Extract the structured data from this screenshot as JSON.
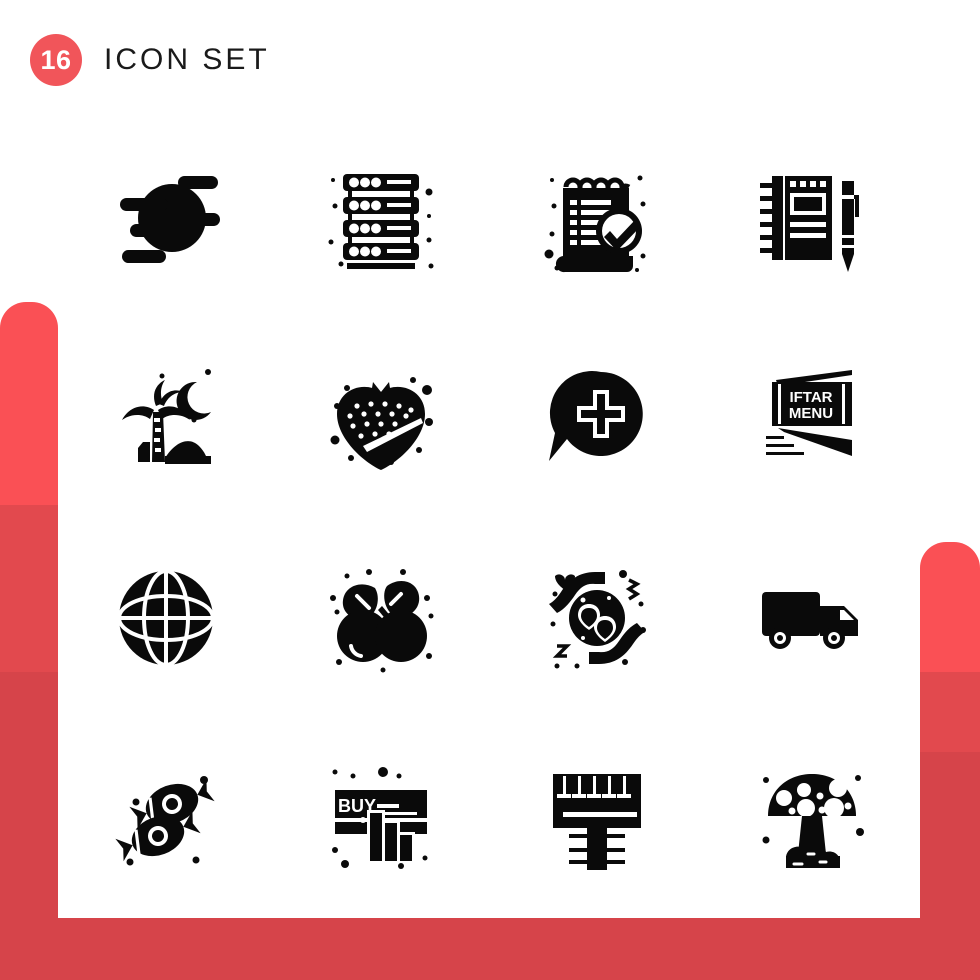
{
  "header": {
    "count": "16",
    "title": "Icon Set"
  },
  "theme": {
    "accent": "#f1555a",
    "accent_light": "#fa5055",
    "accent_mid": "#e2494e",
    "accent_dark": "#d6444a",
    "icon_color": "#0a0a0a",
    "card_bg": "#ffffff"
  },
  "grid": {
    "columns": 4,
    "rows": 4,
    "icons": [
      {
        "index": 1,
        "name": "speed-motion-icon",
        "label": "Fast Speed Motion"
      },
      {
        "index": 2,
        "name": "server-rack-icon",
        "label": "Server Rack"
      },
      {
        "index": 3,
        "name": "checklist-notepad-icon",
        "label": "Checklist Notepad"
      },
      {
        "index": 4,
        "name": "notebook-pen-icon",
        "label": "Notebook And Pen"
      },
      {
        "index": 5,
        "name": "oasis-night-icon",
        "label": "Palm Tree Desert Night"
      },
      {
        "index": 6,
        "name": "strawberry-icon",
        "label": "Strawberry"
      },
      {
        "index": 7,
        "name": "chat-add-icon",
        "label": "Add Chat Message"
      },
      {
        "index": 8,
        "name": "iftar-menu-icon",
        "label": "Iftar Menu Card",
        "text_line_1": "IFTAR",
        "text_line_2": "MENU"
      },
      {
        "index": 9,
        "name": "globe-grid-icon",
        "label": "Globe World"
      },
      {
        "index": 10,
        "name": "berries-icon",
        "label": "Berries Fruit"
      },
      {
        "index": 11,
        "name": "hands-hearts-care-icon",
        "label": "Hands Holding Hearts"
      },
      {
        "index": 12,
        "name": "delivery-truck-icon",
        "label": "Delivery Truck"
      },
      {
        "index": 13,
        "name": "candy-icon",
        "label": "Wrapped Candies"
      },
      {
        "index": 14,
        "name": "buy-banner-icon",
        "label": "Buy Banner Chart",
        "text_line_1": "BUY"
      },
      {
        "index": 15,
        "name": "paint-brush-icon",
        "label": "Paint Brush"
      },
      {
        "index": 16,
        "name": "mushroom-icon",
        "label": "Mushroom"
      }
    ]
  }
}
